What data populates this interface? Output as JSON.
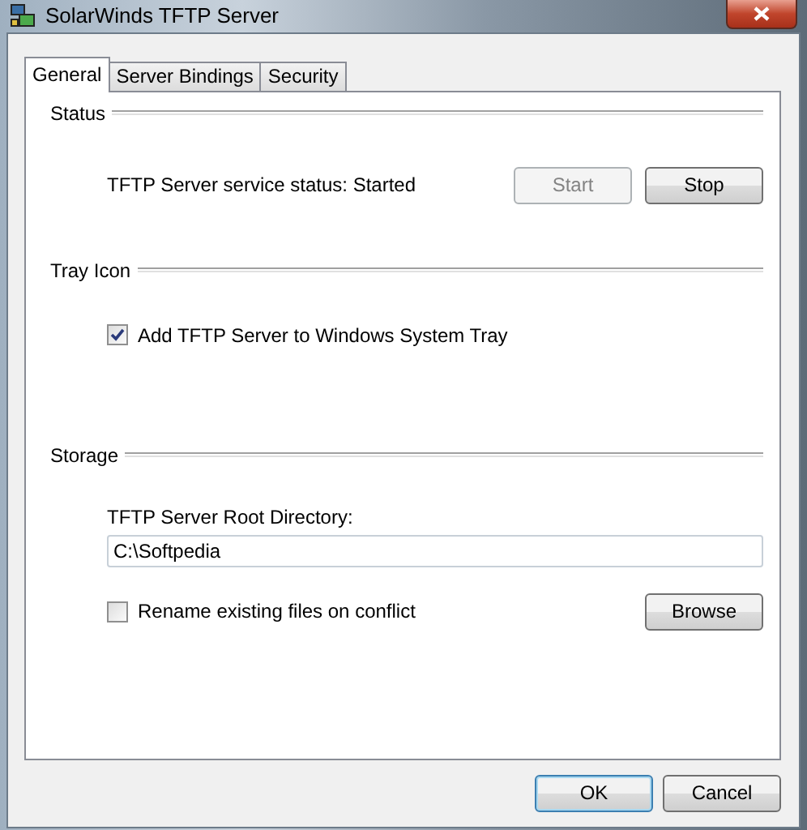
{
  "window": {
    "title": "SolarWinds TFTP Server"
  },
  "tabs": [
    {
      "label": "General",
      "selected": true
    },
    {
      "label": "Server Bindings",
      "selected": false
    },
    {
      "label": "Security",
      "selected": false
    }
  ],
  "sections": [
    {
      "kind": "status",
      "heading": "Status",
      "label": "TFTP Server service status: Started",
      "buttons": [
        {
          "label": "Start",
          "disabled": true
        },
        {
          "label": "Stop",
          "disabled": false
        }
      ]
    },
    {
      "kind": "tray",
      "heading": "Tray Icon",
      "checkbox": {
        "label": "Add TFTP Server to Windows System Tray",
        "checked": true
      }
    },
    {
      "kind": "storage",
      "heading": "Storage",
      "field_label": "TFTP Server Root Directory:",
      "value": "C:\\Softpedia",
      "checkbox": {
        "label": "Rename existing files on conflict",
        "checked": false
      },
      "button": {
        "label": "Browse",
        "disabled": false
      }
    }
  ],
  "buttons": [
    {
      "label": "OK",
      "default": true
    },
    {
      "label": "Cancel",
      "default": false
    }
  ]
}
